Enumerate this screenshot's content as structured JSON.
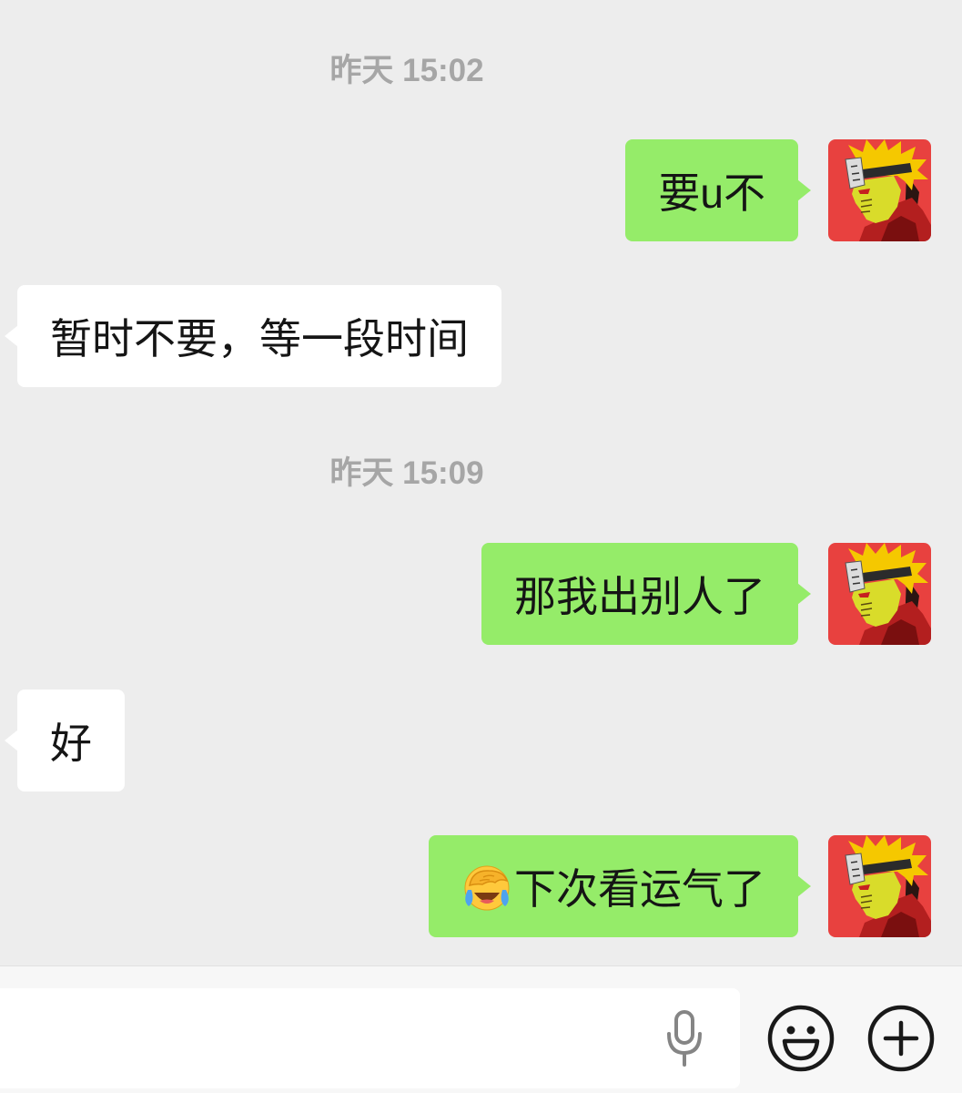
{
  "colors": {
    "chat_background": "#ededed",
    "sent_bubble": "#95ec69",
    "received_bubble": "#ffffff",
    "timestamp_text": "#a6a6a6",
    "input_bar_background": "#f7f7f7"
  },
  "chat": {
    "sections": [
      {
        "timestamp": "昨天 15:02",
        "messages": [
          {
            "sent": "要u不"
          },
          {
            "received": "暂时不要，等一段时间"
          }
        ]
      },
      {
        "timestamp": "昨天 15:09",
        "messages": [
          {
            "sent": "那我出别人了"
          },
          {
            "received": "好"
          },
          {
            "sent": "下次看运气了",
            "emoji": "facepalm-laughing-crying-emoji"
          }
        ]
      }
    ],
    "avatar_icon": "user-avatar-icon"
  },
  "input_bar": {
    "value": "",
    "icons": {
      "voice": "microphone-icon",
      "emoji": "smiley-face-icon",
      "more": "plus-circle-icon"
    }
  }
}
